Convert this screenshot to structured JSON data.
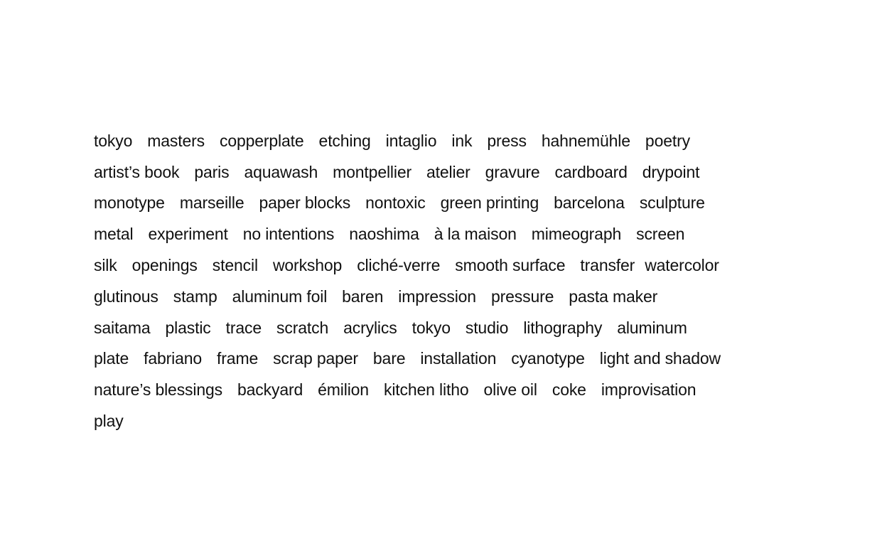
{
  "tags": {
    "rows": [
      [
        "tokyo",
        "masters",
        "copperplate",
        "etching",
        "intaglio",
        "ink",
        "press",
        "hahnemühle",
        "poetry"
      ],
      [
        "artist’s book",
        "paris",
        "aquawash",
        "montpellier",
        "atelier",
        "gravure",
        "cardboard",
        "drypoint"
      ],
      [
        "monotype",
        "marseille",
        "paper blocks",
        "nontoxic",
        "green printing",
        "barcelona",
        "sculpture"
      ],
      [
        "metal",
        "experiment",
        "no intentions",
        "naoshima",
        "à la maison",
        "mimeograph",
        "screen"
      ],
      [
        "silk",
        "openings",
        "stencil",
        "workshop",
        "cliché-verre",
        "smooth surface",
        "transfer",
        "watercolor"
      ],
      [
        "glutinous",
        "stamp",
        "aluminum foil",
        "baren",
        "impression",
        "pressure",
        "pasta maker"
      ],
      [
        "saitama",
        "plastic",
        "trace",
        "scratch",
        "acrylics",
        "tokyo",
        "studio",
        "lithography",
        "aluminum"
      ],
      [
        "plate",
        "fabriano",
        "frame",
        "scrap paper",
        "bare",
        "installation",
        "cyanotype",
        "light and shadow"
      ],
      [
        "nature’s blessings",
        "backyard",
        "émilion",
        "kitchen litho",
        "olive oil",
        "coke",
        "improvisation"
      ],
      [
        "play"
      ]
    ]
  }
}
